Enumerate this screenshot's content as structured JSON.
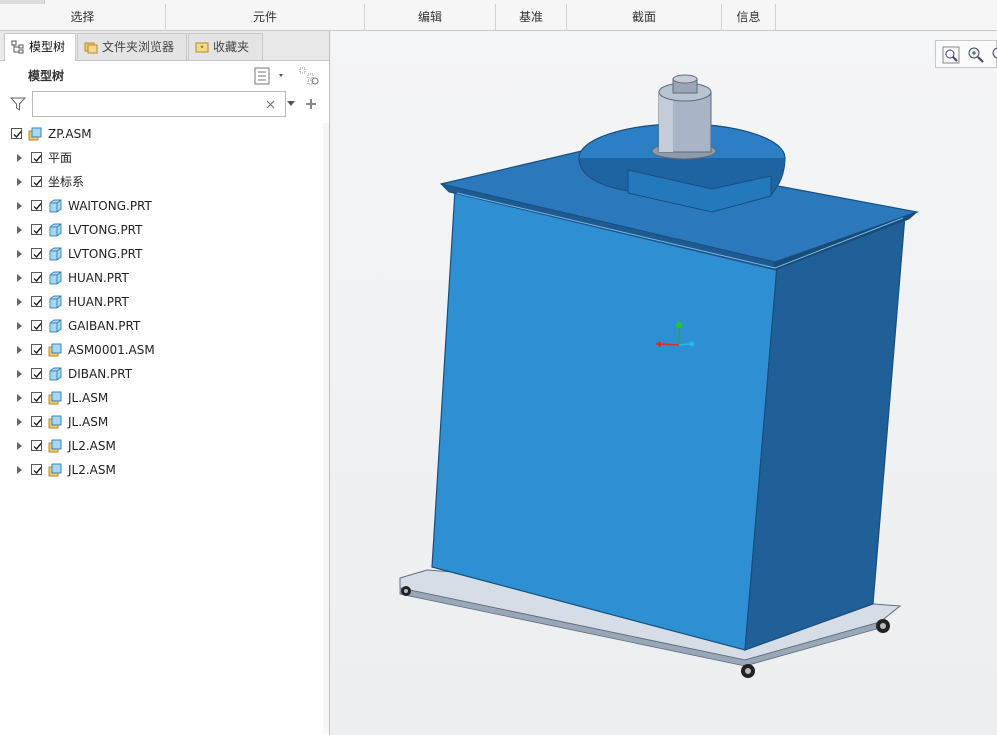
{
  "ribbon": {
    "groups": [
      {
        "label": "选择"
      },
      {
        "label": "元件"
      },
      {
        "label": "编辑"
      },
      {
        "label": "基准"
      },
      {
        "label": "截面"
      },
      {
        "label": "信息"
      }
    ]
  },
  "panel": {
    "tabs": [
      {
        "label": "模型树",
        "icon": "model-tree-icon",
        "active": true
      },
      {
        "label": "文件夹浏览器",
        "icon": "folder-browser-icon",
        "active": false
      },
      {
        "label": "收藏夹",
        "icon": "favorites-icon",
        "active": false
      }
    ],
    "title": "模型树",
    "filter": {
      "value": "",
      "placeholder": ""
    }
  },
  "tree": {
    "root": {
      "label": "ZP.ASM",
      "type": "asm",
      "checked": true
    },
    "items": [
      {
        "label": "平面",
        "type": "none",
        "checked": true
      },
      {
        "label": "坐标系",
        "type": "none",
        "checked": true
      },
      {
        "label": "WAITONG.PRT",
        "type": "prt",
        "checked": true
      },
      {
        "label": "LVTONG.PRT",
        "type": "prt",
        "checked": true
      },
      {
        "label": "LVTONG.PRT",
        "type": "prt",
        "checked": true
      },
      {
        "label": "HUAN.PRT",
        "type": "prt",
        "checked": true
      },
      {
        "label": "HUAN.PRT",
        "type": "prt",
        "checked": true
      },
      {
        "label": "GAIBAN.PRT",
        "type": "prt",
        "checked": true
      },
      {
        "label": "ASM0001.ASM",
        "type": "asm",
        "checked": true
      },
      {
        "label": "DIBAN.PRT",
        "type": "prt",
        "checked": true
      },
      {
        "label": "JL.ASM",
        "type": "asm",
        "checked": true
      },
      {
        "label": "JL.ASM",
        "type": "asm",
        "checked": true
      },
      {
        "label": "JL2.ASM",
        "type": "asm",
        "checked": true
      },
      {
        "label": "JL2.ASM",
        "type": "asm",
        "checked": true
      }
    ]
  },
  "viewport": {
    "toolbar": [
      "refit-icon",
      "zoom-in-icon",
      "zoom-out-icon"
    ],
    "model_colors": {
      "front": "#2f8fd3",
      "side": "#1f5f96",
      "top": "#2b78bc",
      "motor": "#a8b4c4"
    }
  }
}
